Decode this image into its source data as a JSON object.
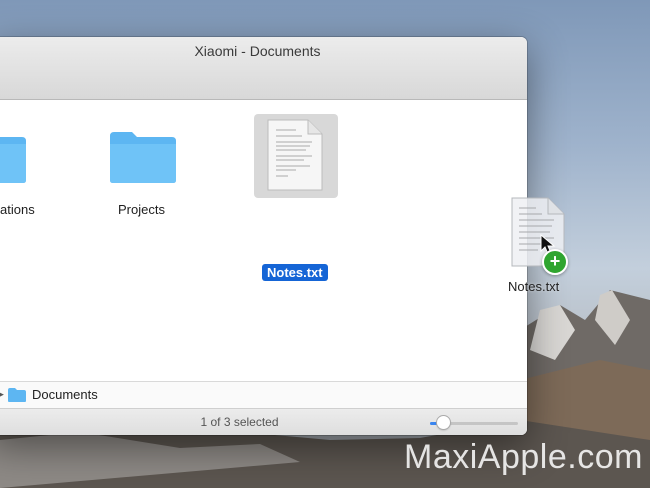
{
  "window": {
    "title": "Xiaomi - Documents",
    "items": [
      {
        "label": "ations",
        "type": "folder"
      },
      {
        "label": "Projects",
        "type": "folder"
      },
      {
        "label": "Notes.txt",
        "type": "text-file",
        "selected": true
      }
    ],
    "path_bar": {
      "folder_icon": "folder-icon",
      "label": "Documents"
    },
    "status": "1 of 3 selected",
    "icon_size_slider": 0.15
  },
  "drag_preview": {
    "label": "Notes.txt",
    "badge": "+"
  },
  "watermark": "MaxiApple.com",
  "colors": {
    "folder": "#5db6f2",
    "selection": "#1565d6",
    "copy_badge": "#2fa52f"
  }
}
